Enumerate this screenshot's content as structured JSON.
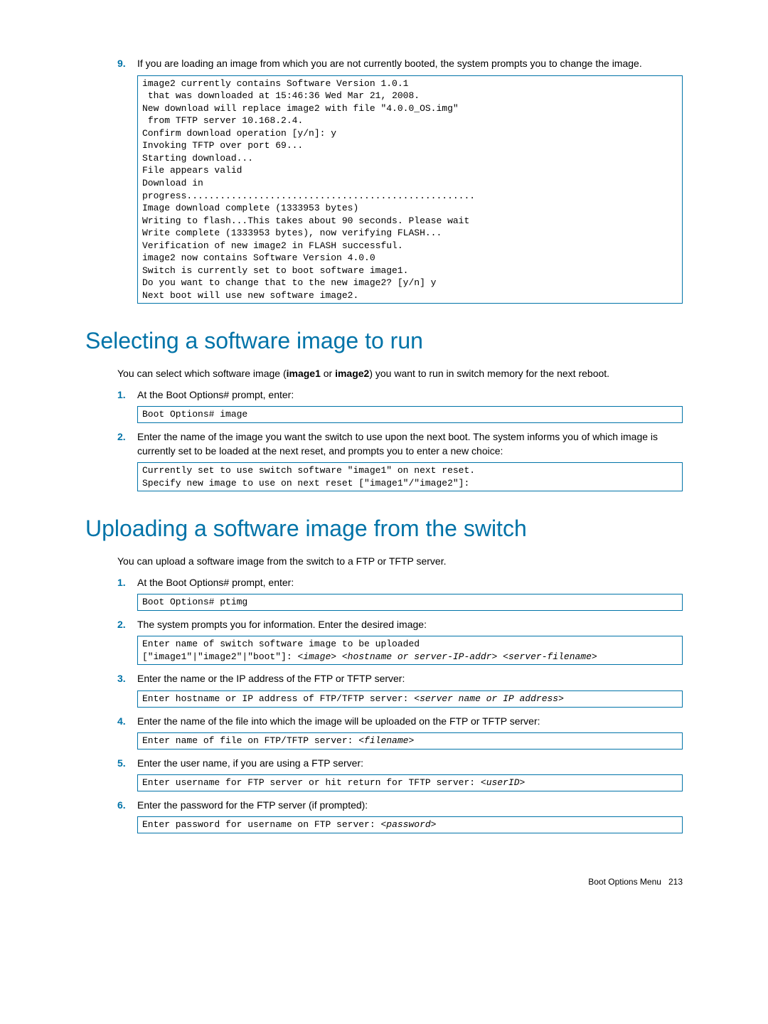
{
  "item9": {
    "num": "9.",
    "text": "If you are loading an image from which you are not currently booted, the system prompts you to change the image.",
    "code": "image2 currently contains Software Version 1.0.1\n that was downloaded at 15:46:36 Wed Mar 21, 2008.\nNew download will replace image2 with file \"4.0.0_OS.img\"\n from TFTP server 10.168.2.4.\nConfirm download operation [y/n]: y\nInvoking TFTP over port 69...\nStarting download...\nFile appears valid\nDownload in\nprogress....................................................\nImage download complete (1333953 bytes)\nWriting to flash...This takes about 90 seconds. Please wait\nWrite complete (1333953 bytes), now verifying FLASH...\nVerification of new image2 in FLASH successful.\nimage2 now contains Software Version 4.0.0\nSwitch is currently set to boot software image1.\nDo you want to change that to the new image2? [y/n] y\nNext boot will use new software image2."
  },
  "section1": {
    "heading": "Selecting a software image to run",
    "intro_pre": "You can select which software image (",
    "intro_b1": "image1",
    "intro_mid": " or ",
    "intro_b2": "image2",
    "intro_post": ") you want to run in switch memory for the next reboot.",
    "step1": {
      "num": "1.",
      "text": "At the Boot Options# prompt, enter:",
      "code": "Boot Options# image"
    },
    "step2": {
      "num": "2.",
      "text": "Enter the name of the image you want the switch to use upon the next boot. The system informs you of which image is currently set to be loaded at the next reset, and prompts you to enter a new choice:",
      "code": "Currently set to use switch software \"image1\" on next reset.\nSpecify new image to use on next reset [\"image1\"/\"image2\"]:"
    }
  },
  "section2": {
    "heading": "Uploading a software image from the switch",
    "intro": "You can upload a software image from the switch to a FTP or TFTP server.",
    "step1": {
      "num": "1.",
      "text": "At the Boot Options# prompt, enter:",
      "code": "Boot Options# ptimg"
    },
    "step2": {
      "num": "2.",
      "text": "The system prompts you for information. Enter the desired image:",
      "code_plain": "Enter name of switch software image to be uploaded\n[\"image1\"|\"image2\"|\"boot\"]: ",
      "code_ital": "<image> <hostname or server-IP-addr> <server-filename>"
    },
    "step3": {
      "num": "3.",
      "text": "Enter the name or the IP address of the FTP or TFTP server:",
      "code_plain": "Enter hostname or IP address of FTP/TFTP server: ",
      "code_ital": "<server name or IP address>"
    },
    "step4": {
      "num": "4.",
      "text": "Enter the name of the file into which the image will be uploaded on the FTP or TFTP server:",
      "code_plain": "Enter name of file on FTP/TFTP server: ",
      "code_ital": "<filename>"
    },
    "step5": {
      "num": "5.",
      "text": "Enter the user name, if you are using a FTP server:",
      "code_plain": "Enter username for FTP server or hit return for TFTP server: ",
      "code_ital": "<userID>"
    },
    "step6": {
      "num": "6.",
      "text": "Enter the password for the FTP server (if prompted):",
      "code_plain": "Enter password for username on FTP server: ",
      "code_ital": "<password>"
    }
  },
  "footer": {
    "label": "Boot Options Menu",
    "page": "213"
  }
}
